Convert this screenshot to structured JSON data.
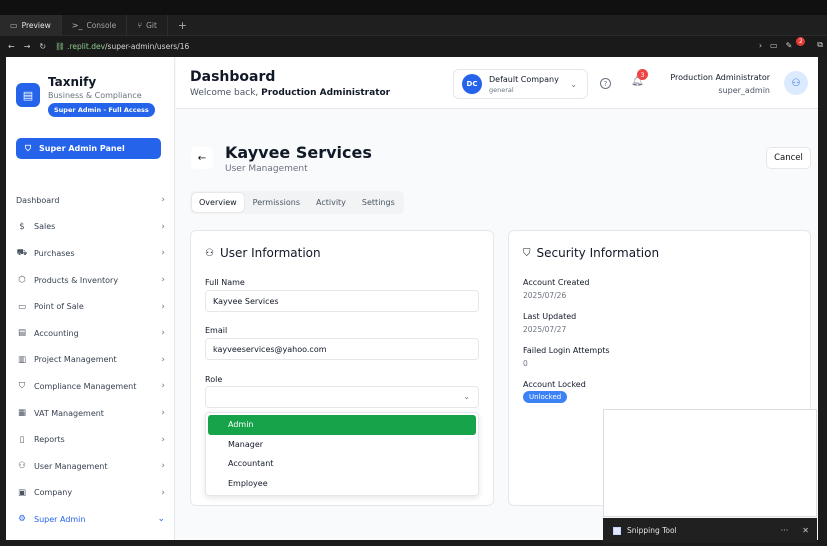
{
  "browser": {
    "tabs": [
      {
        "label": "Preview",
        "icon": "monitor-icon"
      },
      {
        "label": "Console",
        "icon": "terminal-icon"
      },
      {
        "label": "Git",
        "icon": "git-icon"
      }
    ],
    "url_host": ".replit.dev",
    "url_path": "/super-admin/users/16",
    "notif_count": "2"
  },
  "sidebar": {
    "brand": "Taxnify",
    "brand_sub": "Business & Compliance",
    "brand_badge": "Super Admin - Full Access",
    "super_panel": "Super Admin Panel",
    "items": [
      {
        "label": "Dashboard",
        "icon": ""
      },
      {
        "label": "Sales",
        "icon": "$"
      },
      {
        "label": "Purchases",
        "icon": "⛟"
      },
      {
        "label": "Products & Inventory",
        "icon": "⬡"
      },
      {
        "label": "Point of Sale",
        "icon": "▭"
      },
      {
        "label": "Accounting",
        "icon": "▤"
      },
      {
        "label": "Project Management",
        "icon": "▥"
      },
      {
        "label": "Compliance Management",
        "icon": "⛉"
      },
      {
        "label": "VAT Management",
        "icon": "▦"
      },
      {
        "label": "Reports",
        "icon": "▯"
      },
      {
        "label": "User Management",
        "icon": "⚇"
      },
      {
        "label": "Company",
        "icon": "▣"
      },
      {
        "label": "Super Admin",
        "icon": "⚙"
      }
    ]
  },
  "header": {
    "title": "Dashboard",
    "welcome": "Welcome back, ",
    "welcome_name": "Production Administrator",
    "company_initials": "DC",
    "company_name": "Default Company",
    "company_sub": "general",
    "notif_count": "3",
    "user_name": "Production Administrator",
    "user_role": "super_admin"
  },
  "page": {
    "title": "Kayvee Services",
    "subtitle": "User Management",
    "cancel": "Cancel",
    "tabs": [
      "Overview",
      "Permissions",
      "Activity",
      "Settings"
    ]
  },
  "user_info": {
    "title": "User Information",
    "full_name_label": "Full Name",
    "full_name": "Kayvee Services",
    "email_label": "Email",
    "email": "kayveeservices@yahoo.com",
    "role_label": "Role",
    "role_options": [
      "Admin",
      "Manager",
      "Accountant",
      "Employee"
    ]
  },
  "security": {
    "title": "Security Information",
    "created_label": "Account Created",
    "created": "2025/07/26",
    "updated_label": "Last Updated",
    "updated": "2025/07/27",
    "failed_label": "Failed Login Attempts",
    "failed": "0",
    "locked_label": "Account Locked",
    "locked": "Unlocked"
  },
  "snipping": {
    "title": "Snipping Tool"
  },
  "colors": {
    "primary": "#2563eb",
    "selected_option": "#16a34a"
  }
}
